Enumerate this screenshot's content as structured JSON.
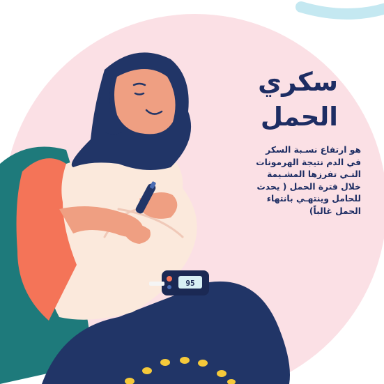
{
  "title": {
    "line1": "سكري",
    "line2": "الحمل"
  },
  "description": {
    "lines": [
      "هو ارتفاع نسـبة السكر",
      "في الدم نتيجة الهرمونات",
      "التـي تفرزها المشـيمة",
      "خلال فترة الحمل ( يحدث",
      "للحامل وينتهـي بانتهاء",
      "الحمل غالباً)"
    ]
  },
  "meter": {
    "reading": "95"
  },
  "colors": {
    "background_circle": "#fbe0e5",
    "hijab": "#213567",
    "skin": "#ef9f82",
    "shirt": "#f47458",
    "dress": "#fbe9dc",
    "chair": "#1e7a7b",
    "accent_arc": "#c4e8f1",
    "coins": "#f5c93a",
    "text": "#1d2d63"
  },
  "icons": [
    "glucose-meter-icon",
    "lancet-pen-icon",
    "coin-icon"
  ]
}
